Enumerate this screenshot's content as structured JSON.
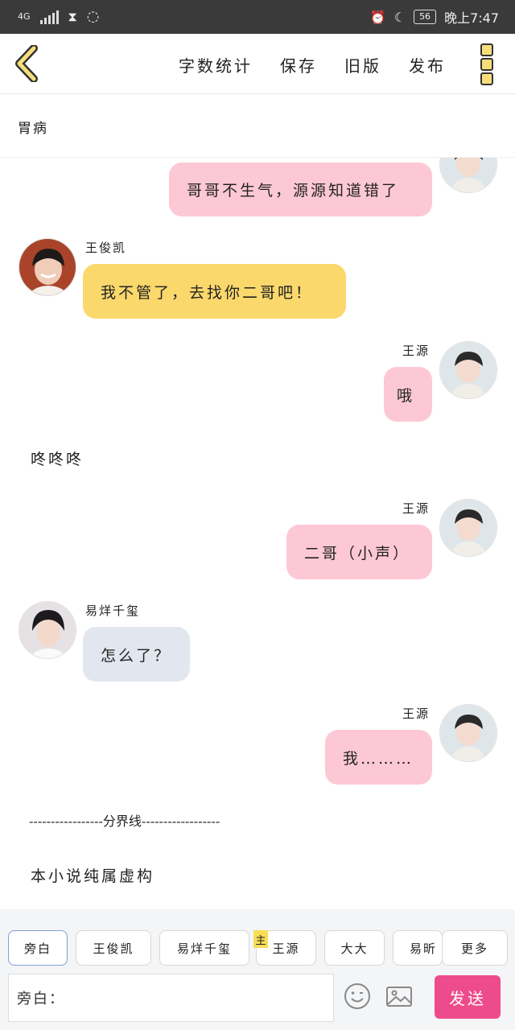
{
  "status_bar": {
    "network": "4G",
    "time": "晚上7:47",
    "battery": "56"
  },
  "toolbar": {
    "word_count": "字数统计",
    "save": "保存",
    "old_version": "旧版",
    "publish": "发布"
  },
  "title": "胃病",
  "messages": [
    {
      "side": "right",
      "speaker": "",
      "text": "哥哥不生气，源源知道错了"
    },
    {
      "side": "left",
      "speaker": "王俊凯",
      "text": "我不管了，去找你二哥吧！"
    },
    {
      "side": "right",
      "speaker": "王源",
      "text": "哦"
    },
    {
      "side": "narration",
      "text": "咚咚咚"
    },
    {
      "side": "right",
      "speaker": "王源",
      "text": "二哥（小声）"
    },
    {
      "side": "left",
      "speaker": "易烊千玺",
      "text": "怎么了？"
    },
    {
      "side": "right",
      "speaker": "王源",
      "text": "我………"
    },
    {
      "side": "narration",
      "text": "-----------------分界线------------------"
    },
    {
      "side": "narration",
      "text": "本小说纯属虚构"
    }
  ],
  "characters": [
    "旁白",
    "王俊凯",
    "易烊千玺",
    "王源",
    "大大",
    "易昕"
  ],
  "main_tag": "主",
  "more": "更多",
  "input_prefix": "旁白：",
  "send": "发送"
}
